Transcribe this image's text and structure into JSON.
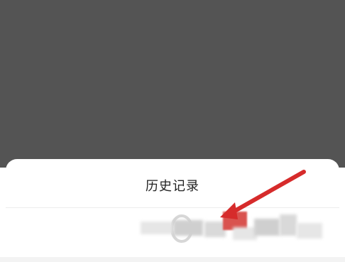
{
  "overlay": {
    "color": "#545454"
  },
  "sheet": {
    "title": "历史记录"
  },
  "history": {
    "item_label": "",
    "icon": "circle-icon"
  },
  "annotation": {
    "arrow_color": "#d62b2b"
  }
}
